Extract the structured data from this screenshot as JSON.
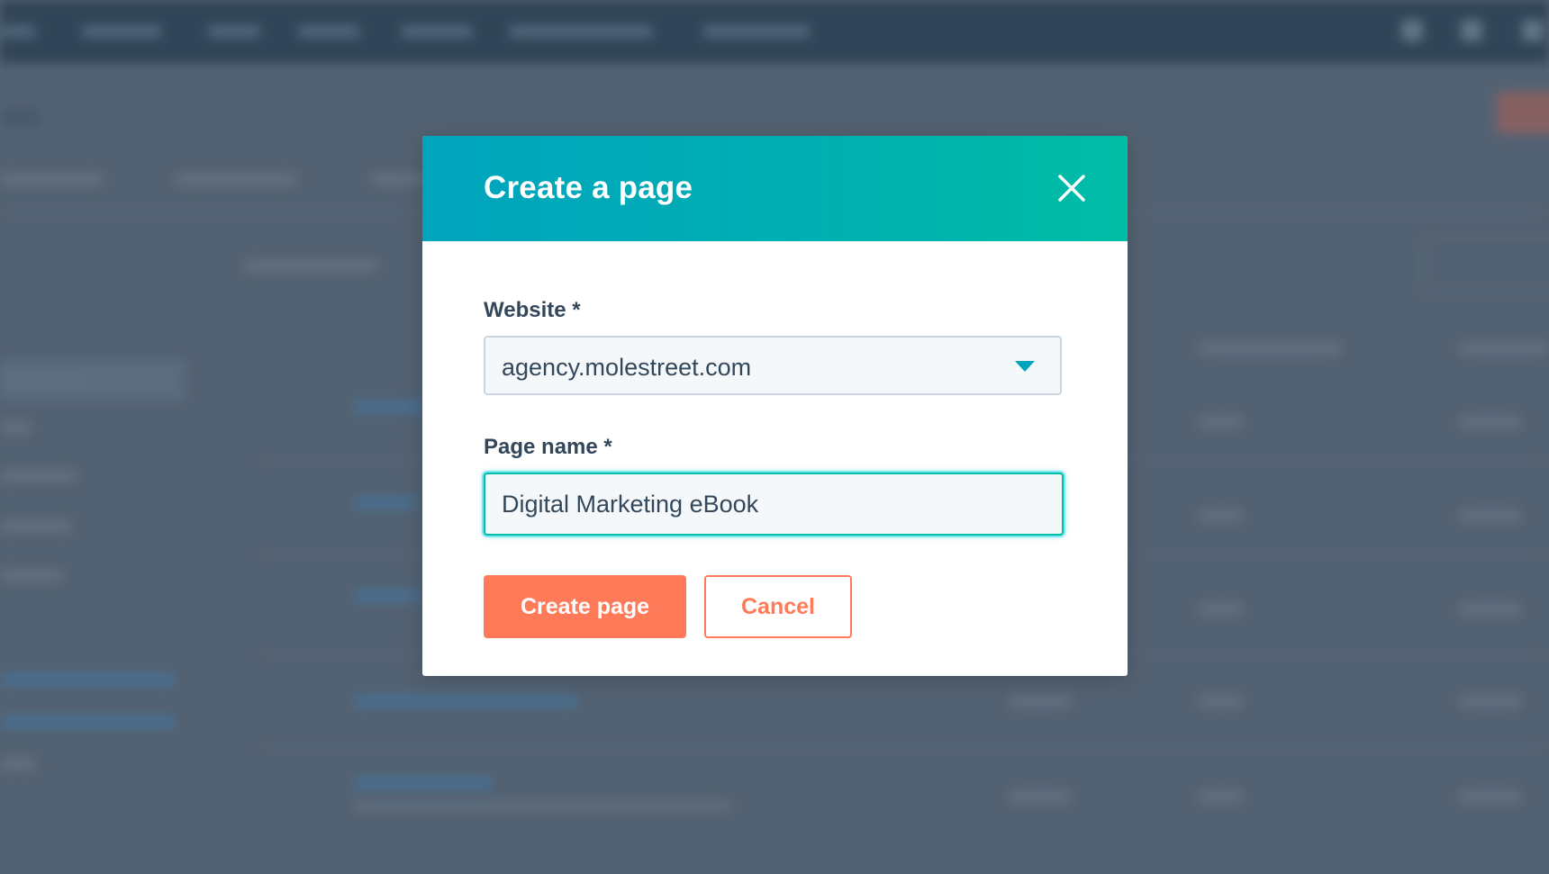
{
  "modal": {
    "title": "Create a page",
    "close_icon": "close-icon",
    "website": {
      "label": "Website *",
      "selected": "agency.molestreet.com"
    },
    "page_name": {
      "label": "Page name *",
      "value": "Digital Marketing eBook"
    },
    "buttons": {
      "create_label": "Create page",
      "cancel_label": "Cancel"
    }
  },
  "colors": {
    "header_start": "#00a4bd",
    "header_end": "#00bda5",
    "primary": "#ff7a59",
    "text": "#33475b",
    "focus": "#00bda5"
  }
}
